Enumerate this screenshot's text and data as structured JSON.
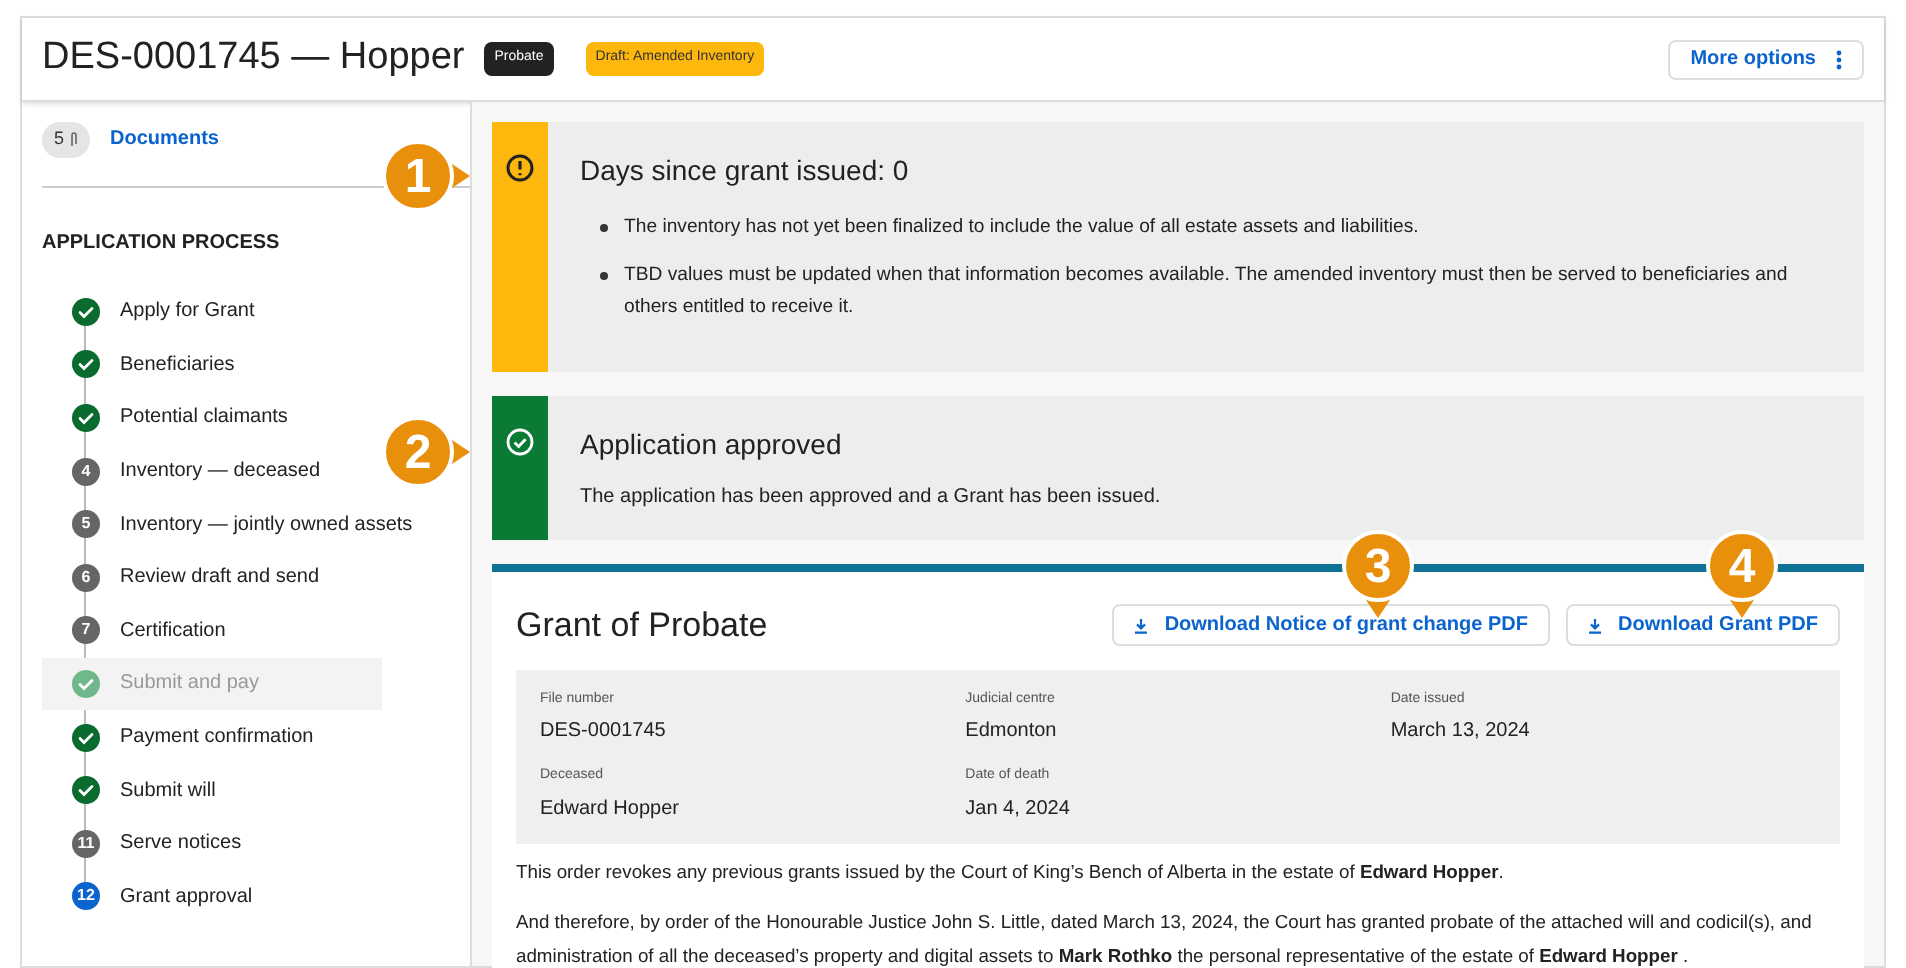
{
  "header": {
    "title": "DES-0001745 — Hopper",
    "badges": [
      {
        "label": "Probate",
        "kind": "dark"
      },
      {
        "label": "Draft: Amended Inventory",
        "kind": "warning"
      }
    ],
    "menu_button": "More options"
  },
  "sidebar": {
    "documents": {
      "count": "5",
      "label": "Documents"
    },
    "section_title": "APPLICATION PROCESS",
    "steps": [
      {
        "label": "Apply for Grant",
        "kind": "done",
        "selected": false
      },
      {
        "label": "Beneficiaries",
        "kind": "done",
        "selected": false
      },
      {
        "label": "Potential claimants",
        "kind": "done",
        "selected": false
      },
      {
        "label": "Inventory — deceased",
        "kind": "todo",
        "number": "4",
        "selected": false
      },
      {
        "label": "Inventory — jointly owned assets",
        "kind": "todo",
        "number": "5",
        "selected": false
      },
      {
        "label": "Review draft and send",
        "kind": "todo",
        "number": "6",
        "selected": false
      },
      {
        "label": "Certification",
        "kind": "todo",
        "number": "7",
        "selected": false
      },
      {
        "label": "Submit and pay",
        "kind": "done",
        "selected": true
      },
      {
        "label": "Payment confirmation",
        "kind": "done",
        "selected": false
      },
      {
        "label": "Submit will",
        "kind": "done",
        "selected": false
      },
      {
        "label": "Serve notices",
        "kind": "todo",
        "number": "11",
        "selected": false
      },
      {
        "label": "Grant approval",
        "kind": "current",
        "number": "12",
        "selected": false
      }
    ]
  },
  "alerts": [
    {
      "kind": "warning",
      "title": "Days since grant issued: 0",
      "bullets": [
        "The inventory has not yet been finalized to include the value of all estate assets and liabilities.",
        "TBD values must be updated when that information becomes available. The amended inventory must then be served to beneficiaries and others entitled to receive it."
      ]
    },
    {
      "kind": "success",
      "title": "Application approved",
      "text": "The application has been approved and a Grant has been issued."
    }
  ],
  "grant": {
    "title": "Grant of Probate",
    "buttons": [
      "Download Notice of grant change PDF",
      "Download Grant PDF"
    ],
    "fields": [
      {
        "label": "File number",
        "value": "DES-0001745"
      },
      {
        "label": "Judicial centre",
        "value": "Edmonton"
      },
      {
        "label": "Date issued",
        "value": "March 13, 2024"
      },
      {
        "label": "Deceased",
        "value": "Edward Hopper"
      },
      {
        "label": "Date of death",
        "value": "Jan 4, 2024"
      }
    ],
    "paragraphs": [
      "This order revokes any previous grants issued by the Court of King’s Bench of Alberta in the estate of **Edward Hopper**.",
      "And therefore, by order of the Honourable Justice John S. Little, dated March 13, 2024, the Court has granted probate of the attached will and codicil(s), and administration of all the deceased’s property and digital assets to **Mark Rothko** the personal representative of the estate of **Edward Hopper** ."
    ]
  },
  "callouts": [
    {
      "label": "1",
      "kind": "right"
    },
    {
      "label": "2",
      "kind": "right"
    },
    {
      "label": "3",
      "kind": "down"
    },
    {
      "label": "4",
      "kind": "down"
    }
  ]
}
